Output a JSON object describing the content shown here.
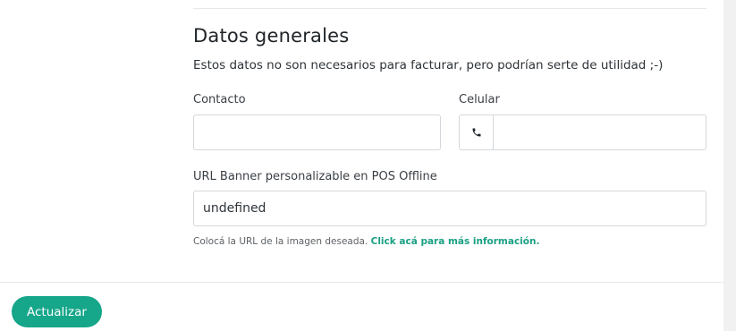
{
  "section": {
    "title": "Datos generales",
    "description": "Estos datos no son necesarios para facturar, pero podrían serte de utilidad ;-)"
  },
  "fields": {
    "contact": {
      "label": "Contacto",
      "value": ""
    },
    "mobile": {
      "label": "Celular",
      "value": "",
      "icon": "phone-icon"
    },
    "banner_url": {
      "label": "URL Banner personalizable en POS Offline",
      "value": "undefined"
    }
  },
  "help": {
    "text": "Colocá la URL de la imagen deseada.",
    "link_text": "Click acá para más información.",
    "link_color": "#1aa084"
  },
  "actions": {
    "update_label": "Actualizar",
    "accent_color": "#16a68a"
  }
}
